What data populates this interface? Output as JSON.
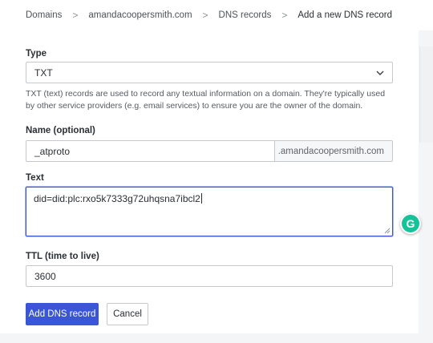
{
  "breadcrumb": {
    "items": [
      "Domains",
      "amandacoopersmith.com",
      "DNS records",
      "Add a new DNS record"
    ],
    "separator": ">"
  },
  "form": {
    "type": {
      "label": "Type",
      "value": "TXT",
      "icon": "chevron-down-icon",
      "helper": "TXT (text) records are used to record any textual information on a domain. They're typically used by other service providers (e.g. email services) to ensure you are the owner of the domain."
    },
    "name": {
      "label": "Name (optional)",
      "value": "_atproto",
      "suffix": ".amandacoopersmith.com"
    },
    "text": {
      "label": "Text",
      "value": "did=did:plc:rxo5k7333g72uhqsna7ibcl2"
    },
    "ttl": {
      "label": "TTL (time to live)",
      "value": "3600"
    }
  },
  "actions": {
    "submit_label": "Add DNS record",
    "cancel_label": "Cancel"
  },
  "grammarly": {
    "letter": "G",
    "icon": "grammarly-icon"
  },
  "colors": {
    "primary": "#3b55d9",
    "grammarly": "#15c39a",
    "border": "#c5c9cd"
  }
}
